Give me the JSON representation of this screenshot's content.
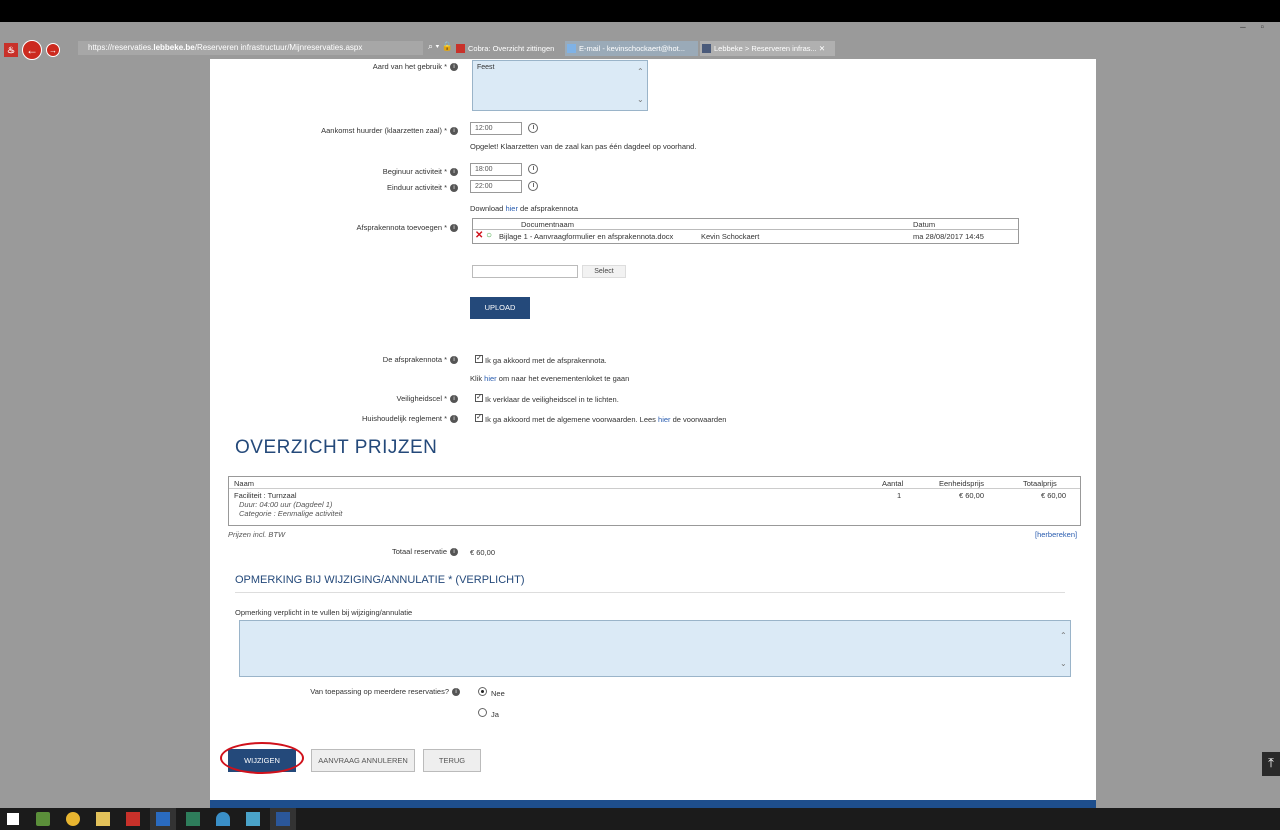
{
  "browser": {
    "url_prefix": "https://reservaties.",
    "url_domain": "lebbeke.be",
    "url_path": "/Reserveren infrastructuur/Mijnreservaties.aspx",
    "url_controls": "⌕ ▾ 🔒 C",
    "tabs": [
      {
        "label": "Cobra: Overzicht zittingen"
      },
      {
        "label": "E-mail - kevinschockaert@hot..."
      },
      {
        "label": "Lebbeke > Reserveren infras... ✕"
      }
    ],
    "window_controls": "– ▫"
  },
  "form": {
    "aard_label": "Aard van het gebruik *",
    "aard_value": "Feest",
    "aankomst_label": "Aankomst huurder (klaarzetten zaal) *",
    "aankomst_value": "12:00",
    "aankomst_note": "Opgelet! Klaarzetten van de zaal kan pas één dagdeel op voorhand.",
    "begin_label": "Beginuur activiteit *",
    "begin_value": "18:00",
    "eind_label": "Einduur activiteit *",
    "eind_value": "22:00",
    "download_pre": "Download ",
    "download_link": "hier",
    "download_post": " de afsprakennota",
    "afspraken_label": "Afsprakennota toevoegen *",
    "doc_headers": {
      "name": "Documentnaam",
      "date": "Datum"
    },
    "doc_row": {
      "name": "Bijlage 1 - Aanvraagformulier en afsprakennota.docx",
      "user": "Kevin Schockaert",
      "date": "ma 28/08/2017 14:45"
    },
    "select_label": "Select",
    "upload_label": "UPLOAD",
    "afsprakennota_label": "De afsprakennota *",
    "afsprakennota_check": "Ik ga akkoord met de afsprakennota.",
    "klik_pre": "Klik ",
    "klik_link": "hier",
    "klik_post": " om naar het evenementenloket te gaan",
    "veiligheid_label": "Veiligheidscel *",
    "veiligheid_check": "Ik verklaar de veiligheidscel in te lichten.",
    "huishoud_label": "Huishoudelijk reglement *",
    "huishoud_check_pre": "Ik ga akkoord met de algemene voorwaarden. Lees ",
    "huishoud_link": "hier",
    "huishoud_check_post": " de voorwaarden",
    "checked_glyph": "✓"
  },
  "prices": {
    "heading": "OVERZICHT PRIJZEN",
    "headers": {
      "name": "Naam",
      "qty": "Aantal",
      "unit": "Eenheidsprijs",
      "total": "Totaalprijs"
    },
    "row": {
      "facility": "Faciliteit : Turnzaal",
      "duration": "Duur: 04:00 uur (Dagdeel 1)",
      "category": "Categorie : Eenmalige activiteit",
      "qty": "1",
      "unit": "€ 60,00",
      "total": "€ 60,00"
    },
    "note": "Prijzen incl. BTW",
    "recalc": "[herbereken]",
    "total_label": "Totaal reservatie",
    "total_value": "€ 60,00"
  },
  "remark": {
    "heading": "OPMERKING BIJ WIJZIGING/ANNULATIE * (VERPLICHT)",
    "hint": "Opmerking verplicht in te vullen bij wijziging/annulatie",
    "value": "",
    "multi_label": "Van toepassing op meerdere reservaties?",
    "option_no": "Nee",
    "option_yes": "Ja",
    "selected": "Nee"
  },
  "buttons": {
    "save": "WIJZIGEN",
    "cancel": "AANVRAAG ANNULEREN",
    "back": "TERUG"
  },
  "scroll_top_glyph": "⤒",
  "icons": {
    "info": "i",
    "remove": "✕",
    "ok": "○",
    "up": "⌃",
    "down": "⌄"
  },
  "colors": {
    "accent": "#24497a",
    "link": "#2a5db0",
    "highlight": "#d0111b",
    "field": "#dbeaf6"
  }
}
